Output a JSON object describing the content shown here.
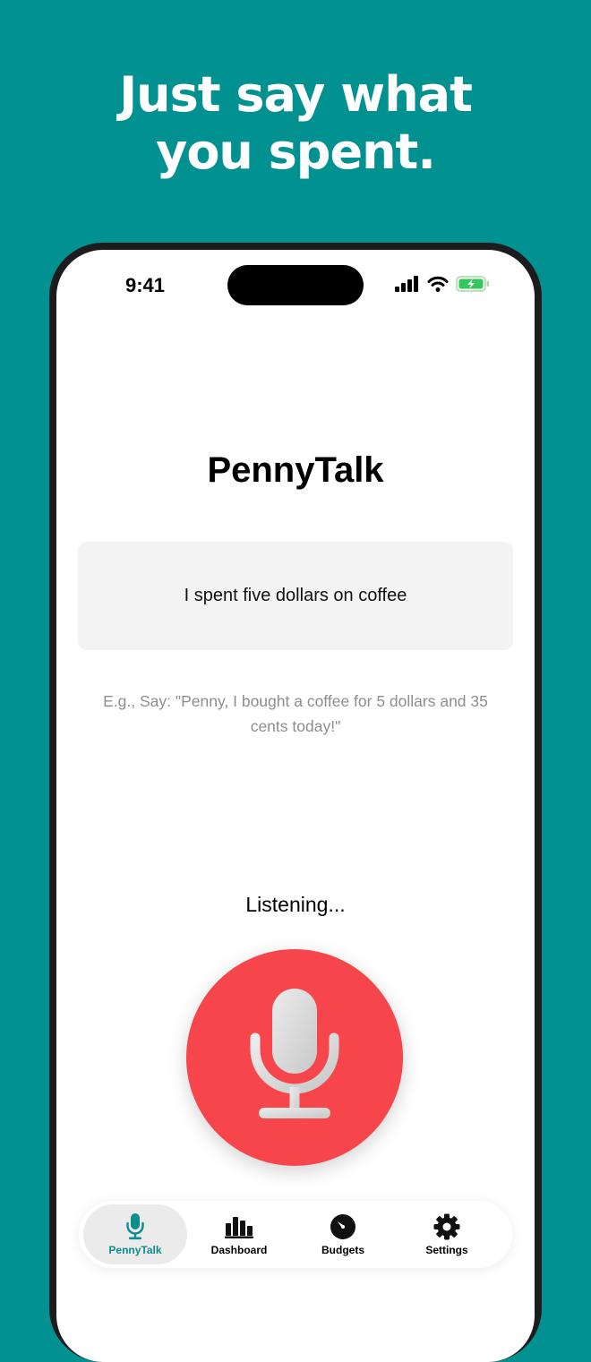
{
  "headline": {
    "line1": "Just say what",
    "line2": "you spent."
  },
  "status_bar": {
    "time": "9:41"
  },
  "app": {
    "title": "PennyTalk",
    "transcript": "I spent five dollars on coffee",
    "example": "E.g., Say: \"Penny, I bought a coffee for 5 dollars and 35 cents today!\"",
    "status": "Listening...",
    "mic_icon": "microphone-icon"
  },
  "tab_bar": {
    "tabs": [
      {
        "label": "PennyTalk",
        "icon": "microphone-icon",
        "active": true
      },
      {
        "label": "Dashboard",
        "icon": "bar-chart-icon",
        "active": false
      },
      {
        "label": "Budgets",
        "icon": "gauge-icon",
        "active": false
      },
      {
        "label": "Settings",
        "icon": "gear-icon",
        "active": false
      }
    ]
  },
  "colors": {
    "background": "#009190",
    "mic_button": "#f7454c",
    "active_tab": "#0c8e8d",
    "battery": "#34c759"
  }
}
